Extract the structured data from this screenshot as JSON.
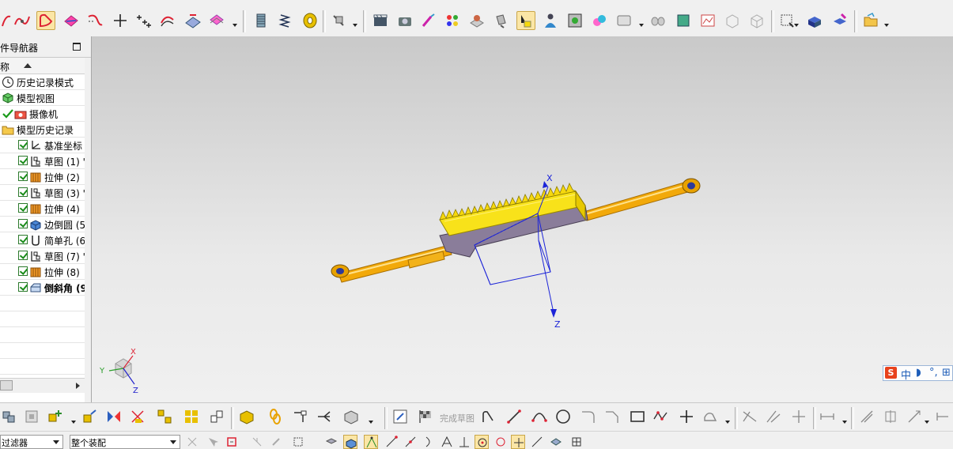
{
  "navigator": {
    "title": "件导航器",
    "column_header": "称",
    "rows": [
      {
        "label": "历史记录模式",
        "icon": "clock-icon"
      },
      {
        "label": "模型视图",
        "icon": "model-view-icon"
      },
      {
        "label": "摄像机",
        "icon": "camera-icon"
      },
      {
        "label": "模型历史记录",
        "icon": "folder-icon"
      },
      {
        "label": "基准坐标",
        "icon": "datum-csys-icon"
      },
      {
        "label": "草图 (1) '",
        "icon": "sketch-icon"
      },
      {
        "label": "拉伸 (2)",
        "icon": "extrude-icon"
      },
      {
        "label": "草图 (3) '",
        "icon": "sketch-icon"
      },
      {
        "label": "拉伸 (4)",
        "icon": "extrude-icon"
      },
      {
        "label": "边倒圆 (5",
        "icon": "edge-blend-icon"
      },
      {
        "label": "简单孔 (6",
        "icon": "hole-icon"
      },
      {
        "label": "草图 (7) '",
        "icon": "sketch-icon"
      },
      {
        "label": "拉伸 (8)",
        "icon": "extrude-icon"
      },
      {
        "label": "倒斜角 (9",
        "icon": "chamfer-icon"
      }
    ]
  },
  "viewport": {
    "axis_labels": {
      "x": "X",
      "z": "Z"
    },
    "triad_labels": {
      "x": "X",
      "y": "Y",
      "z": "Z"
    }
  },
  "ime": {
    "logo": "S",
    "mode": "中",
    "moon": "◗",
    "punct": "°,",
    "more": "⊞"
  },
  "bottom_toolbar": {
    "sketch_finish_label": "完成草图"
  },
  "selection_bar": {
    "filter_value": "过滤器",
    "scope_value": "整个装配"
  },
  "colors": {
    "part_yellow": "#f6d80e",
    "part_orange": "#f2a90a",
    "csys_blue": "#1c24d8",
    "viewport_bg": "#dedede"
  }
}
